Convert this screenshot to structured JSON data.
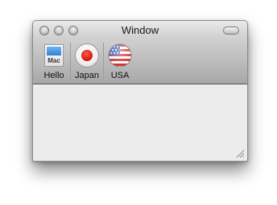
{
  "window": {
    "title": "Window"
  },
  "toolbar": {
    "items": [
      {
        "label": "Hello",
        "icon": "mac-icon",
        "icon_text": "Mac"
      },
      {
        "label": "Japan",
        "icon": "japan-flag-icon"
      },
      {
        "label": "USA",
        "icon": "usa-flag-icon"
      }
    ]
  }
}
